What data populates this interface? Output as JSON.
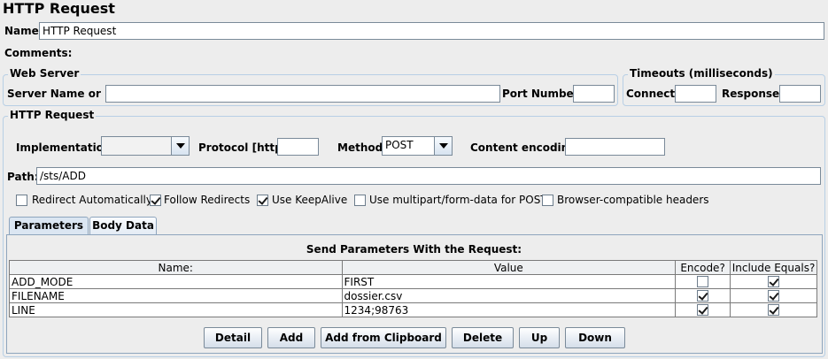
{
  "title": "HTTP Request",
  "name": {
    "label": "Name:",
    "value": "HTTP Request"
  },
  "comments": {
    "label": "Comments:",
    "value": ""
  },
  "web_server": {
    "legend": "Web Server",
    "server_label": "Server Name or IP:",
    "server_value": "",
    "port_label": "Port Number:",
    "port_value": ""
  },
  "timeouts": {
    "legend": "Timeouts (milliseconds)",
    "connect_label": "Connect:",
    "connect_value": "",
    "response_label": "Response:",
    "response_value": ""
  },
  "http_request": {
    "legend": "HTTP Request",
    "implementation_label": "Implementation:",
    "implementation_value": "",
    "protocol_label": "Protocol [http]:",
    "protocol_value": "",
    "method_label": "Method:",
    "method_value": "POST",
    "encoding_label": "Content encoding:",
    "encoding_value": "",
    "path_label": "Path:",
    "path_value": "/sts/ADD"
  },
  "options": [
    {
      "label": "Redirect Automatically",
      "checked": false
    },
    {
      "label": "Follow Redirects",
      "checked": true
    },
    {
      "label": "Use KeepAlive",
      "checked": true
    },
    {
      "label": "Use multipart/form-data for POST",
      "checked": false
    },
    {
      "label": "Browser-compatible headers",
      "checked": false
    }
  ],
  "tabs": [
    {
      "label": "Parameters",
      "active": true
    },
    {
      "label": "Body Data",
      "active": false
    }
  ],
  "params": {
    "caption": "Send Parameters With the Request:",
    "headers": [
      "Name:",
      "Value",
      "Encode?",
      "Include Equals?"
    ],
    "rows": [
      {
        "name": "ADD_MODE",
        "value": "FIRST",
        "encode": false,
        "equals": true
      },
      {
        "name": "FILENAME",
        "value": "dossier.csv",
        "encode": true,
        "equals": true
      },
      {
        "name": "LINE",
        "value": "1234;98763",
        "encode": true,
        "equals": true
      }
    ]
  },
  "buttons": {
    "detail": "Detail",
    "add": "Add",
    "add_clipboard": "Add from Clipboard",
    "delete": "Delete",
    "up": "Up",
    "down": "Down"
  }
}
